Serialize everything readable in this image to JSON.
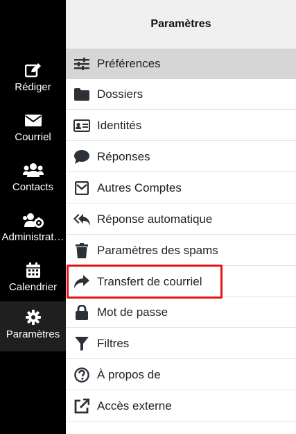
{
  "sidebar": {
    "items": [
      {
        "label": "Rédiger",
        "icon": "edit-icon"
      },
      {
        "label": "Courriel",
        "icon": "envelope-icon"
      },
      {
        "label": "Contacts",
        "icon": "users-icon"
      },
      {
        "label": "Administrat…",
        "icon": "users-cog-icon"
      },
      {
        "label": "Calendrier",
        "icon": "calendar-icon"
      },
      {
        "label": "Paramètres",
        "icon": "gear-icon"
      }
    ]
  },
  "panel": {
    "title": "Paramètres",
    "items": [
      {
        "label": "Préférences",
        "icon": "sliders-icon"
      },
      {
        "label": "Dossiers",
        "icon": "folder-icon"
      },
      {
        "label": "Identités",
        "icon": "id-card-icon"
      },
      {
        "label": "Réponses",
        "icon": "comment-icon"
      },
      {
        "label": "Autres Comptes",
        "icon": "envelope-square-icon"
      },
      {
        "label": "Réponse automatique",
        "icon": "reply-all-icon"
      },
      {
        "label": "Paramètres des spams",
        "icon": "trash-icon"
      },
      {
        "label": "Transfert de courriel",
        "icon": "share-arrow-icon"
      },
      {
        "label": "Mot de passe",
        "icon": "lock-icon"
      },
      {
        "label": "Filtres",
        "icon": "filter-icon"
      },
      {
        "label": "À propos de",
        "icon": "question-circle-icon"
      },
      {
        "label": "Accès externe",
        "icon": "external-link-icon"
      }
    ]
  },
  "colors": {
    "rail_bg": "#000000",
    "rail_active_bg": "#1f1f1f",
    "selected_bg": "#d6d6d6",
    "header_bg": "#f0f0f0",
    "highlight": "#e81414",
    "icon": "#2b3137"
  }
}
